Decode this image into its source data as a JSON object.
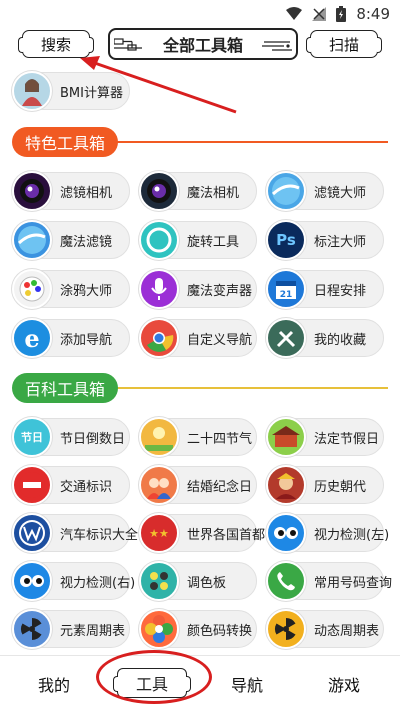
{
  "status_bar": {
    "time": "8:49"
  },
  "header": {
    "search_label": "搜索",
    "title": "全部工具箱",
    "scan_label": "扫描"
  },
  "top_tool": {
    "label": "BMI计算器",
    "icon": "bmi-person-icon",
    "color": "#b6d7e6"
  },
  "sections": [
    {
      "title": "特色工具箱",
      "color": "#f15a22"
    },
    {
      "title": "百科工具箱",
      "color": "#3aa845"
    }
  ],
  "featured_tools": [
    {
      "label": "滤镜相机",
      "icon": "camera-lens-icon",
      "color": "#2a0f3d"
    },
    {
      "label": "魔法相机",
      "icon": "camera-lens-icon",
      "color": "#1d2a3a"
    },
    {
      "label": "滤镜大师",
      "icon": "sphere-icon",
      "color": "#4aa6e6"
    },
    {
      "label": "魔法滤镜",
      "icon": "sphere-icon",
      "color": "#3b93e0"
    },
    {
      "label": "旋转工具",
      "icon": "ring-icon",
      "color": "#2fc3c0"
    },
    {
      "label": "标注大师",
      "icon": "ps-icon",
      "color": "#0a2a5c"
    },
    {
      "label": "涂鸦大师",
      "icon": "palette-icon",
      "color": "#f3f3f3"
    },
    {
      "label": "魔法变声器",
      "icon": "microphone-icon",
      "color": "#9b2fd6"
    },
    {
      "label": "日程安排",
      "icon": "calendar-icon",
      "color": "#1e78d8"
    },
    {
      "label": "添加导航",
      "icon": "ie-browser-icon",
      "color": "#1d8ee0"
    },
    {
      "label": "自定义导航",
      "icon": "chrome-icon",
      "color": "#e84a3c"
    },
    {
      "label": "我的收藏",
      "icon": "tools-icon",
      "color": "#3b6b5a"
    }
  ],
  "encyclopedia_tools": [
    {
      "label": "节日倒数日",
      "icon": "festival-icon",
      "color": "#3fc3d8"
    },
    {
      "label": "二十四节气",
      "icon": "season-icon",
      "color": "#f2b840"
    },
    {
      "label": "法定节假日",
      "icon": "holiday-icon",
      "color": "#8ccf4a"
    },
    {
      "label": "交通标识",
      "icon": "no-entry-icon",
      "color": "#e22b2b"
    },
    {
      "label": "结婚纪念日",
      "icon": "wedding-icon",
      "color": "#f07a48"
    },
    {
      "label": "历史朝代",
      "icon": "dynasty-icon",
      "color": "#b33a2b"
    },
    {
      "label": "汽车标识大全",
      "icon": "vw-logo-icon",
      "color": "#1d4fa0"
    },
    {
      "label": "世界各国首都",
      "icon": "flag-icon",
      "color": "#d82c2c"
    },
    {
      "label": "视力检测(左)",
      "icon": "eye-icon",
      "color": "#1e88e5"
    },
    {
      "label": "视力检测(右)",
      "icon": "eye-icon",
      "color": "#1e88e5"
    },
    {
      "label": "调色板",
      "icon": "color-dots-icon",
      "color": "#2fb3a8"
    },
    {
      "label": "常用号码查询",
      "icon": "phone-icon",
      "color": "#3aa845"
    },
    {
      "label": "元素周期表",
      "icon": "radiation-icon",
      "color": "#5a8fd8"
    },
    {
      "label": "颜色码转换",
      "icon": "flower-icon",
      "color": "#ff6a3d"
    },
    {
      "label": "动态周期表",
      "icon": "radiation-icon",
      "color": "#f2b01e"
    }
  ],
  "bottom_nav": [
    {
      "label": "我的"
    },
    {
      "label": "工具"
    },
    {
      "label": "导航"
    },
    {
      "label": "游戏"
    }
  ]
}
